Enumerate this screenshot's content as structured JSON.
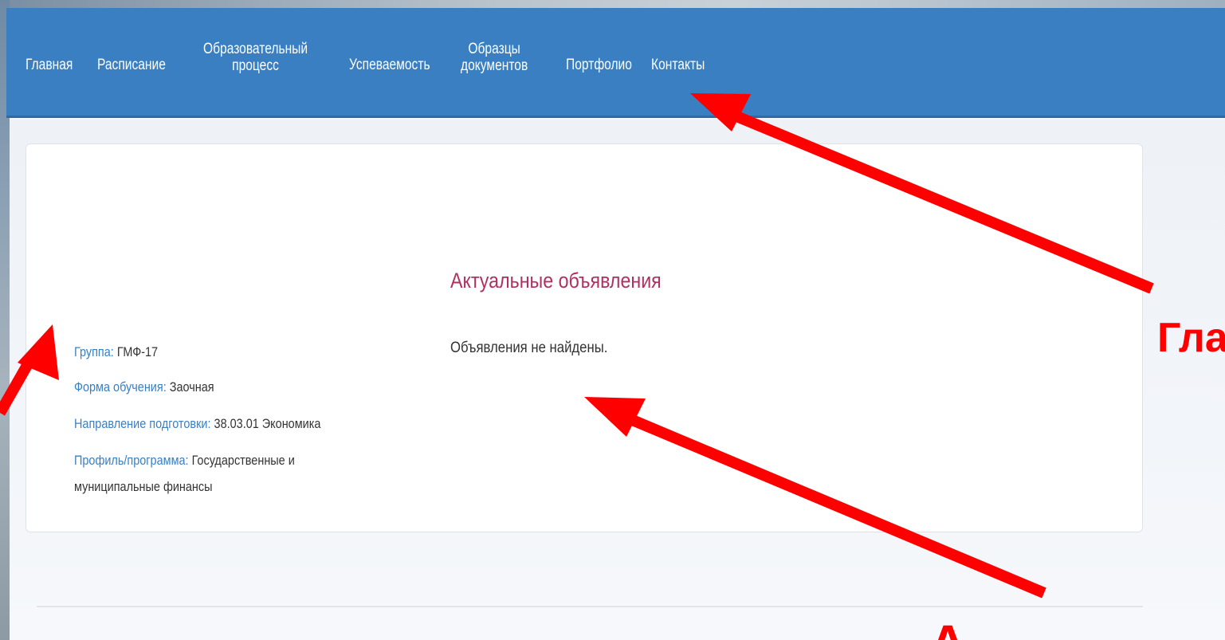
{
  "nav": {
    "items": [
      {
        "label": "Главная"
      },
      {
        "label": "Расписание"
      },
      {
        "label": "Образовательный\nпроцесс"
      },
      {
        "label": "Успеваемость"
      },
      {
        "label": "Образцы\nдокументов"
      },
      {
        "label": "Портфолио"
      },
      {
        "label": "Контакты"
      }
    ]
  },
  "profile": {
    "group_label": "Группа:",
    "group_value": " ГМФ-17",
    "form_label": "Форма обучения:",
    "form_value": " Заочная",
    "direction_label": "Направление подготовки:",
    "direction_value": " 38.03.01 Экономика",
    "program_label": "Профиль/программа:",
    "program_value": " Государственные и",
    "program_value_line2": "муниципальные финансы"
  },
  "announcements": {
    "title": "Актуальные объявления",
    "empty_text": "Объявления не найдены."
  },
  "overlay": {
    "right_label": "Гла",
    "bottom_label": "А"
  },
  "colors": {
    "nav_bg": "#3a7fc1",
    "label_blue": "#3a7fc1",
    "title_crimson": "#b03060",
    "arrow_red": "#ff0000"
  }
}
